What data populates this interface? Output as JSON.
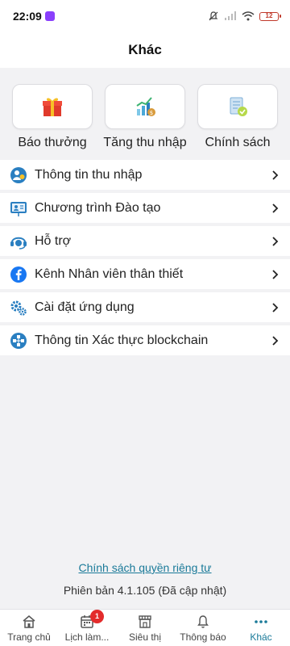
{
  "status_bar": {
    "time": "22:09",
    "battery": "12"
  },
  "header": {
    "title": "Khác"
  },
  "quick_actions": [
    {
      "label": "Báo thưởng",
      "icon": "gift-icon"
    },
    {
      "label": "Tăng thu nhập",
      "icon": "income-growth-icon"
    },
    {
      "label": "Chính sách",
      "icon": "policy-document-icon"
    }
  ],
  "menu": [
    {
      "label": "Thông tin thu nhập",
      "icon": "income-info-icon"
    },
    {
      "label": "Chương trình Đào tạo",
      "icon": "training-icon"
    },
    {
      "label": "Hỗ trợ",
      "icon": "support-headset-icon"
    },
    {
      "label": "Kênh Nhân viên thân thiết",
      "icon": "facebook-icon"
    },
    {
      "label": "Cài đặt ứng dụng",
      "icon": "settings-gear-icon"
    },
    {
      "label": "Thông tin Xác thực blockchain",
      "icon": "blockchain-icon"
    }
  ],
  "footer": {
    "privacy_link": "Chính sách quyền riêng tư",
    "version": "Phiên bản 4.1.105 (Đã cập nhật)"
  },
  "tabbar": {
    "tabs": [
      {
        "label": "Trang chủ",
        "icon": "home-icon"
      },
      {
        "label": "Lịch làm...",
        "icon": "calendar-icon",
        "badge": "1"
      },
      {
        "label": "Siêu thị",
        "icon": "store-icon"
      },
      {
        "label": "Thông báo",
        "icon": "bell-icon"
      },
      {
        "label": "Khác",
        "icon": "more-dots-icon"
      }
    ]
  },
  "colors": {
    "accent": "#1a7a99",
    "badge": "#e32b2b",
    "icon_blue": "#2a7fc1"
  }
}
